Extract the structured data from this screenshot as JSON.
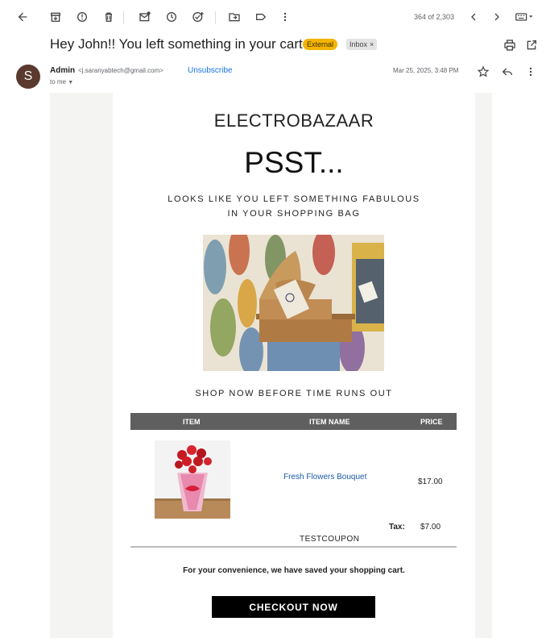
{
  "toolbar": {
    "page_count": "364 of 2,303",
    "icons": [
      "back-arrow-icon",
      "archive-icon",
      "report-spam-icon",
      "delete-icon",
      "mark-unread-icon",
      "snooze-icon",
      "add-task-icon",
      "move-to-icon",
      "label-icon",
      "more-vert-icon",
      "newer-icon",
      "older-icon",
      "input-tools-icon"
    ]
  },
  "email": {
    "subject": "Hey John!! You left something in your cart",
    "labels": {
      "external": "External",
      "inbox": "Inbox",
      "inbox_remove": "×"
    },
    "sender": {
      "avatar_letter": "S",
      "name": "Admin",
      "email": "<j.saranyabtech@gmail.com>",
      "unsubscribe": "Unsubscribe",
      "to": "to me",
      "date": "Mar 25, 2025, 3:48 PM"
    }
  },
  "body": {
    "brand": "ELECTROBAZAAR",
    "headline": "PSST...",
    "tagline_line1": "LOOKS LIKE YOU LEFT SOMETHING FABULOUS",
    "tagline_line2": "IN YOUR SHOPPING BAG",
    "shop_now": "SHOP NOW BEFORE TIME RUNS OUT",
    "table": {
      "headers": [
        "ITEM",
        "ITEM NAME",
        "PRICE"
      ],
      "rows": [
        {
          "name": "Fresh Flowers Bouquet",
          "price": "$17.00"
        }
      ]
    },
    "tax_label": "Tax:",
    "tax_value": "$7.00",
    "coupon": "TESTCOUPON",
    "convenience": "For your convenience, we have saved your shopping cart.",
    "checkout": "CHECKOUT NOW"
  },
  "colors": {
    "accent_link": "#1a73e8",
    "external_label": "#f4b400",
    "table_header": "#5f5f5f",
    "checkout_button": "#000000"
  }
}
